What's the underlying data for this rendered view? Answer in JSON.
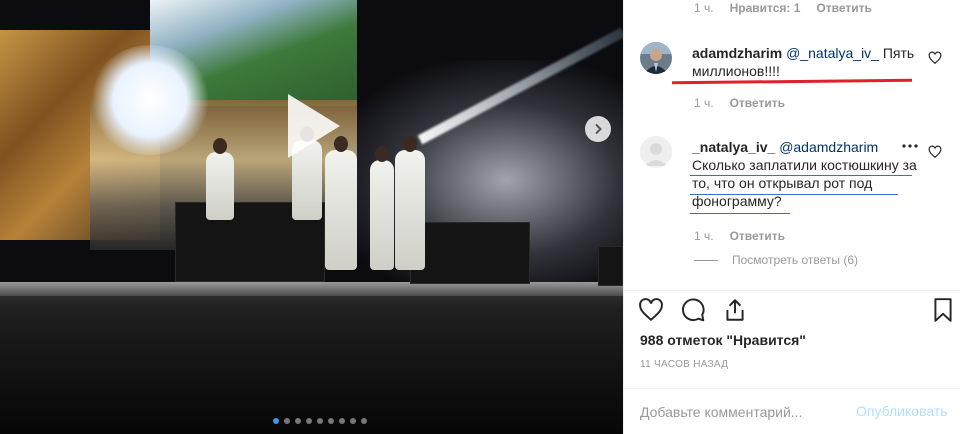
{
  "post": {
    "carousel": {
      "slide_count": 9,
      "active_index": 0
    }
  },
  "comments": [
    {
      "meta_time": "1 ч.",
      "meta_likes": "Нравится: 1",
      "meta_reply": "Ответить"
    },
    {
      "username": "adamdzharim",
      "mention": "@_natalya_iv_",
      "text": "Пять миллионов!!!!",
      "meta_time": "1 ч.",
      "meta_reply": "Ответить"
    },
    {
      "username": "_natalya_iv_",
      "mention": "@adamdzharim",
      "text": "Сколько заплатили костюшкину за то, что он открывал рот под фонограмму?",
      "meta_time": "1 ч.",
      "meta_reply": "Ответить",
      "view_replies": "Посмотреть ответы (6)"
    }
  ],
  "likes_text": "988 отметок \"Нравится\"",
  "timestamp": "11 ЧАСОВ НАЗАД",
  "comment_input": {
    "placeholder": "Добавьте комментарий..."
  },
  "publish_label": "Опубликовать",
  "colors": {
    "link": "#003569",
    "publish_disabled": "#b2dffc",
    "highlight_red": "#e0202a",
    "dot_active": "#3897f0"
  },
  "icons": [
    "play-icon",
    "chevron-right-icon",
    "heart-icon",
    "comment-icon",
    "share-icon",
    "bookmark-icon",
    "more-icon"
  ]
}
